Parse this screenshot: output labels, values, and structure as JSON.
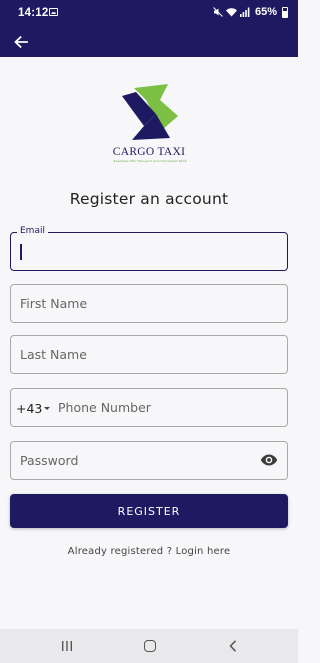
{
  "status_bar": {
    "time": "14:12",
    "battery": "65%",
    "icons": [
      "photo-icon",
      "mute-icon",
      "wifi-icon",
      "signal-icon",
      "battery-icon"
    ]
  },
  "app_bar": {
    "back_icon": "arrow-left-icon"
  },
  "logo": {
    "title": "CARGO TAXI",
    "tagline": "Seamless HGV Transport and Stonehand Rank",
    "colors": {
      "navy": "#1d1a62",
      "green": "#7cc043"
    }
  },
  "page": {
    "title": "Register an account"
  },
  "form": {
    "email": {
      "label": "Email",
      "value": ""
    },
    "first_name": {
      "placeholder": "First Name",
      "value": ""
    },
    "last_name": {
      "placeholder": "Last Name",
      "value": ""
    },
    "phone": {
      "dial_code": "+43",
      "placeholder": "Phone Number",
      "value": ""
    },
    "password": {
      "placeholder": "Password",
      "value": "",
      "toggle_icon": "eye-icon"
    },
    "register_label": "REGISTER",
    "login_text": "Already registered ? Login here"
  },
  "nav_bar": {
    "icons": [
      "recent-apps-icon",
      "home-icon",
      "back-icon"
    ]
  },
  "colors": {
    "primary": "#1d1a62",
    "background": "#f7f7f9",
    "field_border": "#a9a9a9"
  }
}
